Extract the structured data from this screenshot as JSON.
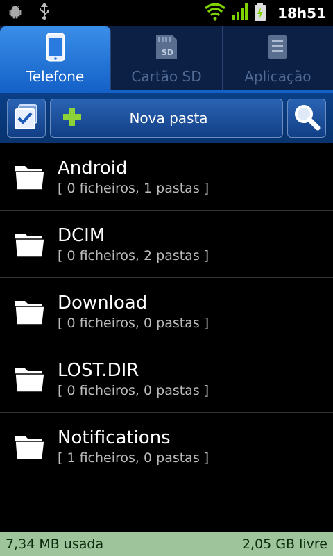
{
  "status_bar": {
    "time": "18h51",
    "icons": [
      "android-debug-icon",
      "usb-icon",
      "wifi-icon",
      "signal-icon",
      "battery-charging-icon"
    ]
  },
  "tabs": [
    {
      "label": "Telefone",
      "icon": "phone-icon",
      "active": true
    },
    {
      "label": "Cartão SD",
      "icon": "sd-card-icon",
      "active": false
    },
    {
      "label": "Aplicação",
      "icon": "application-icon",
      "active": false
    }
  ],
  "toolbar": {
    "new_folder_label": "Nova pasta"
  },
  "folders": [
    {
      "name": "Android",
      "meta": "[ 0 ficheiros, 1 pastas ]"
    },
    {
      "name": "DCIM",
      "meta": "[ 0 ficheiros, 2 pastas ]"
    },
    {
      "name": "Download",
      "meta": "[ 0 ficheiros, 0 pastas ]"
    },
    {
      "name": "LOST.DIR",
      "meta": "[ 0 ficheiros, 0 pastas ]"
    },
    {
      "name": "Notifications",
      "meta": "[ 1 ficheiros, 0 pastas ]"
    }
  ],
  "storage": {
    "used": "7,34 MB usada",
    "free": "2,05 GB livre"
  },
  "colors": {
    "accent": "#1461c8",
    "bottom_bar": "#9dc49a",
    "wifi": "#7fd400"
  }
}
